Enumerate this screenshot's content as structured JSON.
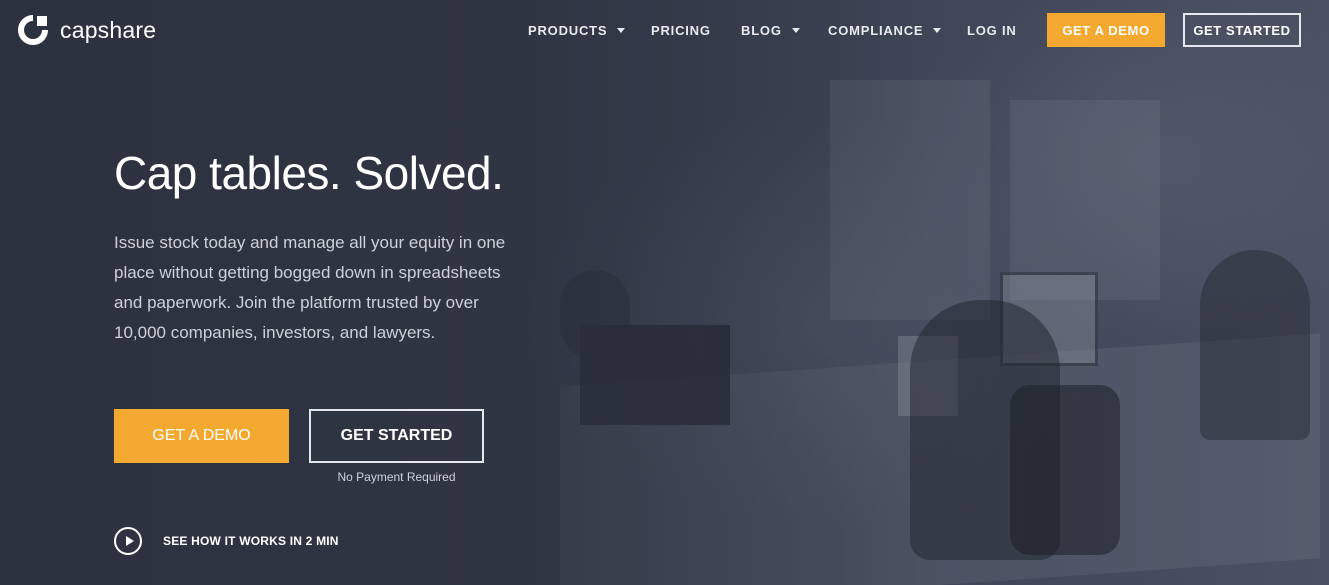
{
  "brand": {
    "name": "capshare",
    "accent_color": "#f3a92f"
  },
  "nav": {
    "items": [
      {
        "label": "PRODUCTS",
        "has_dropdown": true
      },
      {
        "label": "PRICING",
        "has_dropdown": false
      },
      {
        "label": "BLOG",
        "has_dropdown": true
      },
      {
        "label": "COMPLIANCE",
        "has_dropdown": true
      },
      {
        "label": "LOG IN",
        "has_dropdown": false
      }
    ],
    "demo_button": "GET A DEMO",
    "start_button": "GET STARTED"
  },
  "hero": {
    "title": "Cap tables. Solved.",
    "subtitle": "Issue stock today and manage all your equity in one place without getting bogged down in spreadsheets and paperwork. Join the platform trusted by over 10,000 companies, investors, and lawyers.",
    "demo_button": "GET A DEMO",
    "start_button": "GET STARTED",
    "start_note": "No Payment Required",
    "video_link": "SEE HOW IT WORKS IN 2 MIN"
  }
}
